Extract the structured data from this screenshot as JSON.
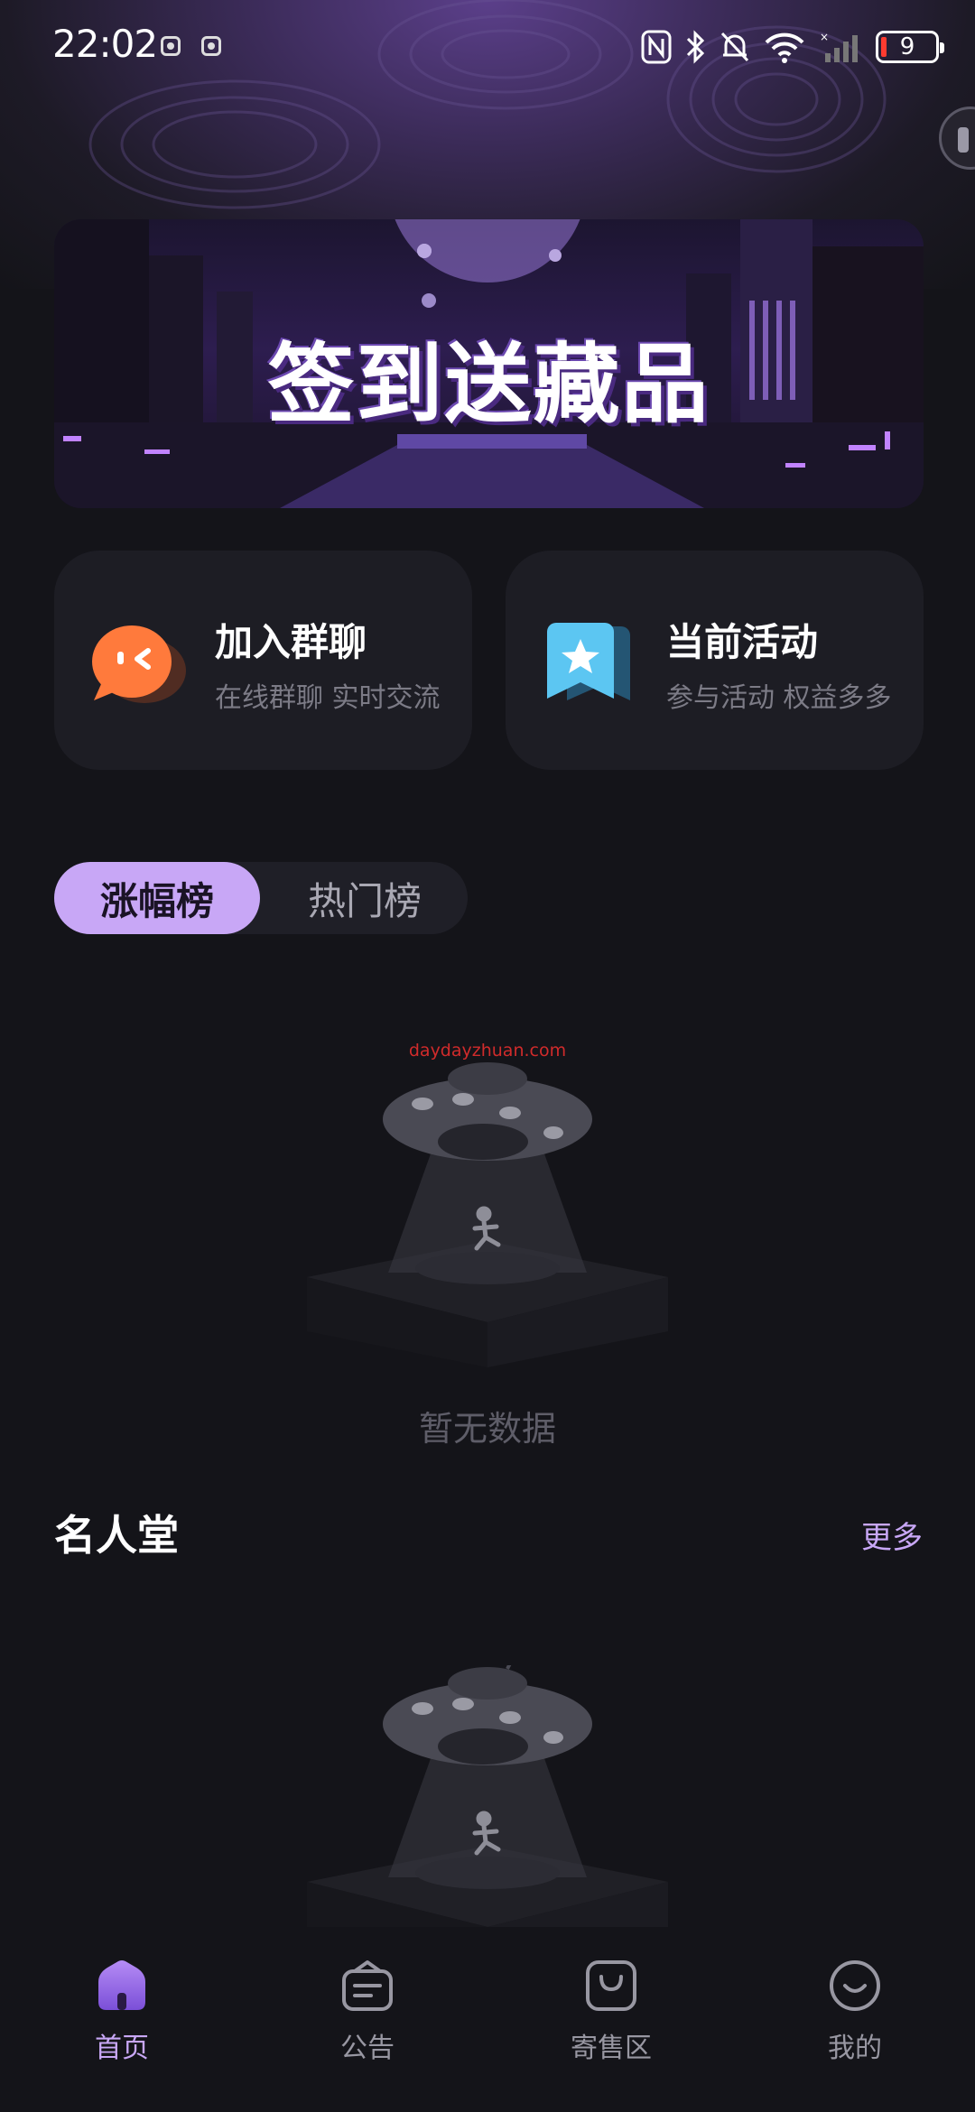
{
  "status_bar": {
    "time": "22:02",
    "battery": "9"
  },
  "banner": {
    "title": "签到送藏品"
  },
  "quick_actions": [
    {
      "title": "加入群聊",
      "subtitle": "在线群聊 实时交流",
      "icon": "chat-bubble-icon"
    },
    {
      "title": "当前活动",
      "subtitle": "参与活动 权益多多",
      "icon": "bookmark-star-icon"
    }
  ],
  "ranking_tabs": [
    {
      "label": "涨幅榜",
      "active": true
    },
    {
      "label": "热门榜",
      "active": false
    }
  ],
  "watermark": "daydayzhuan.com",
  "empty_state": {
    "text": "暂无数据"
  },
  "hall_of_fame": {
    "title": "名人堂",
    "more_label": "更多"
  },
  "bottom_nav": [
    {
      "label": "首页",
      "icon": "home-icon",
      "active": true
    },
    {
      "label": "公告",
      "icon": "announcement-icon",
      "active": false
    },
    {
      "label": "寄售区",
      "icon": "shopping-bag-icon",
      "active": false
    },
    {
      "label": "我的",
      "icon": "profile-smile-icon",
      "active": false
    }
  ],
  "colors": {
    "background": "#141419",
    "card": "#1d1d24",
    "accent": "#c8a7f6",
    "muted_text": "#7c7b86"
  }
}
